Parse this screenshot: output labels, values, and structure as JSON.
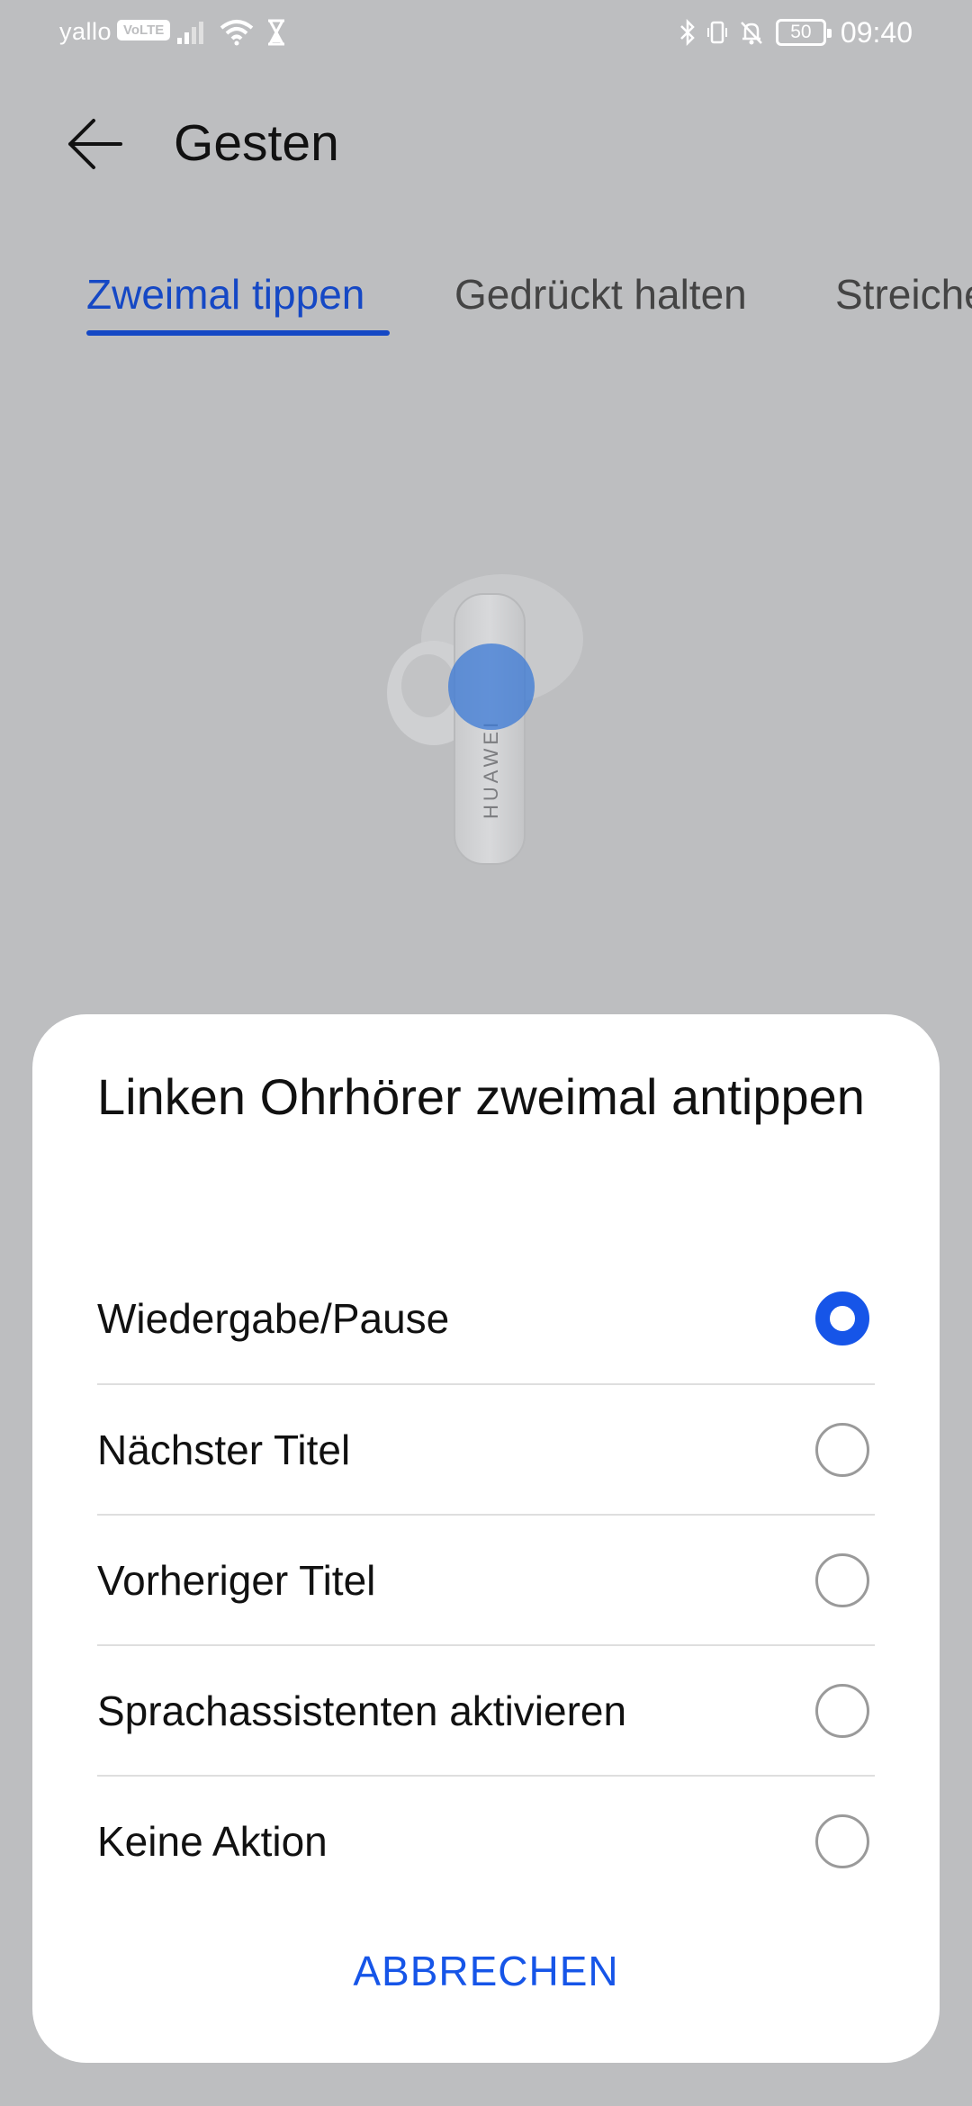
{
  "status_bar": {
    "carrier": "yallo",
    "volte_badge": "VoLTE",
    "battery": "50",
    "time": "09:40",
    "icons": [
      "signal-icon",
      "wifi-icon",
      "hourglass-icon",
      "bluetooth-icon",
      "vibrate-icon",
      "bell-muted-icon",
      "battery-icon"
    ]
  },
  "header": {
    "title": "Gesten",
    "back_icon": "arrow-left-icon"
  },
  "tabs": [
    {
      "label": "Zweimal tippen",
      "active": true
    },
    {
      "label": "Gedrückt halten",
      "active": false
    },
    {
      "label": "Streichen",
      "active": false
    }
  ],
  "illustration": {
    "brand": "HUAWEI",
    "icon": "earbud-icon"
  },
  "sheet": {
    "title": "Linken Ohrhörer zweimal antippen",
    "options": [
      {
        "label": "Wiedergabe/Pause",
        "selected": true
      },
      {
        "label": "Nächster Titel",
        "selected": false
      },
      {
        "label": "Vorheriger Titel",
        "selected": false
      },
      {
        "label": "Sprachassistenten aktivieren",
        "selected": false
      },
      {
        "label": "Keine Aktion",
        "selected": false
      }
    ],
    "cancel_label": "ABBRECHEN"
  },
  "colors": {
    "accent": "#1655e8",
    "tab_active": "#1548c5",
    "overlay_background": "#bdbec0",
    "sheet_background": "#ffffff"
  }
}
